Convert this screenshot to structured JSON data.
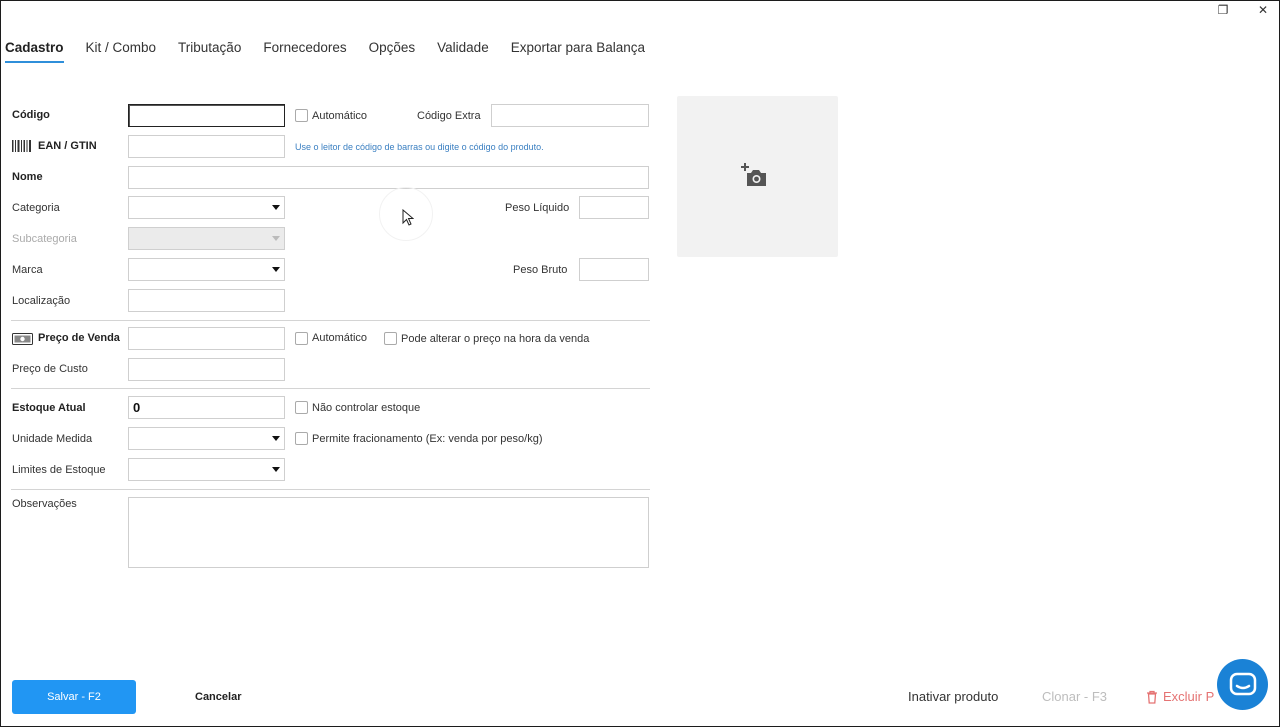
{
  "window": {
    "restore_icon": "❐",
    "close_icon": "✕"
  },
  "tabs": [
    {
      "label": "Cadastro"
    },
    {
      "label": "Kit / Combo"
    },
    {
      "label": "Tributação"
    },
    {
      "label": "Fornecedores"
    },
    {
      "label": "Opções"
    },
    {
      "label": "Validade"
    },
    {
      "label": "Exportar para Balança"
    }
  ],
  "form": {
    "codigo_label": "Código",
    "codigo_value": "",
    "automatico_label": "Automático",
    "codigo_extra_label": "Código Extra",
    "ean_label": "EAN / GTIN",
    "ean_hint": "Use o leitor de código de barras ou digite o código do produto.",
    "nome_label": "Nome",
    "categoria_label": "Categoria",
    "subcategoria_label": "Subcategoria",
    "marca_label": "Marca",
    "localizacao_label": "Localização",
    "peso_liquido_label": "Peso Líquido",
    "peso_bruto_label": "Peso Bruto",
    "preco_venda_label": "Preço de Venda",
    "preco_automatico_label": "Automático",
    "pode_alterar_label": "Pode alterar o preço na hora da venda",
    "preco_custo_label": "Preço de Custo",
    "estoque_atual_label": "Estoque Atual",
    "estoque_atual_value": "0",
    "nao_controlar_label": "Não controlar estoque",
    "unidade_medida_label": "Unidade Medida",
    "fracionamento_label": "Permite fracionamento (Ex: venda por peso/kg)",
    "limites_estoque_label": "Limites de Estoque",
    "observacoes_label": "Observações"
  },
  "footer": {
    "save_label": "Salvar - F2",
    "cancel_label": "Cancelar",
    "inactivate_label": "Inativar produto",
    "clone_label": "Clonar - F3",
    "delete_label": "Excluir P"
  },
  "colors": {
    "accent": "#2196f3",
    "tab_underline": "#2f8fda",
    "danger": "#e57373",
    "chat": "#1a82d6"
  }
}
